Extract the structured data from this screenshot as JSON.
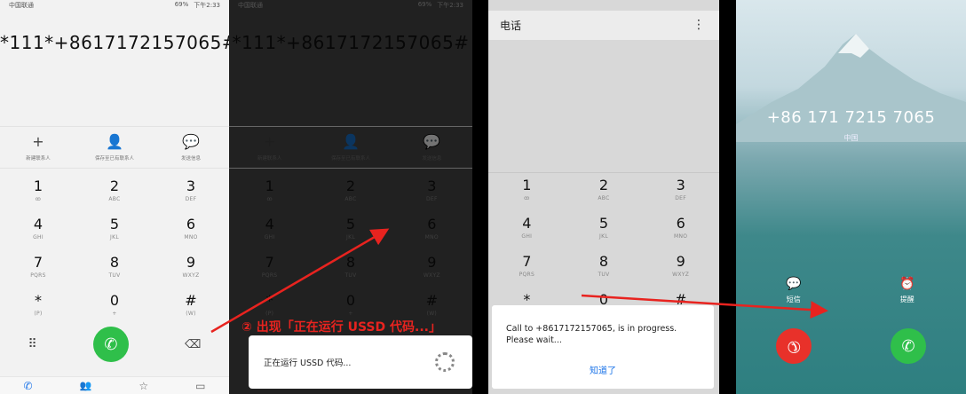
{
  "status": {
    "carrier": "中国联通",
    "battery": "69%",
    "time": "下午2:33"
  },
  "dialed_number": "*111*+8617172157065#",
  "actions": [
    {
      "icon": "plus-icon",
      "label": "新建联系人"
    },
    {
      "icon": "person-icon",
      "label": "保存至已有联系人"
    },
    {
      "icon": "chat-icon",
      "label": "发送信息"
    }
  ],
  "keys": [
    {
      "digit": "1",
      "letters": "ꝏ"
    },
    {
      "digit": "2",
      "letters": "ABC"
    },
    {
      "digit": "3",
      "letters": "DEF"
    },
    {
      "digit": "4",
      "letters": "GHI"
    },
    {
      "digit": "5",
      "letters": "JKL"
    },
    {
      "digit": "6",
      "letters": "MNO"
    },
    {
      "digit": "7",
      "letters": "PQRS"
    },
    {
      "digit": "8",
      "letters": "TUV"
    },
    {
      "digit": "9",
      "letters": "WXYZ"
    },
    {
      "digit": "*",
      "letters": "(P)"
    },
    {
      "digit": "0",
      "letters": "+"
    },
    {
      "digit": "#",
      "letters": "(W)"
    }
  ],
  "ussd_running": "正在运行 USSD 代码...",
  "annotation": "② 出现「正在运行 USSD 代码...」",
  "phone_header": "电话",
  "dialog": {
    "message": "Call to +8617172157065, is in progress. Please wait...",
    "ok": "知道了"
  },
  "incoming": {
    "number": "+86 171 7215 7065",
    "location": "中国",
    "sms": "短信",
    "remind": "提醒"
  },
  "colors": {
    "call_green": "#2fbf4a",
    "hangup_red": "#e8312a",
    "annotation_red": "#e8231f"
  }
}
